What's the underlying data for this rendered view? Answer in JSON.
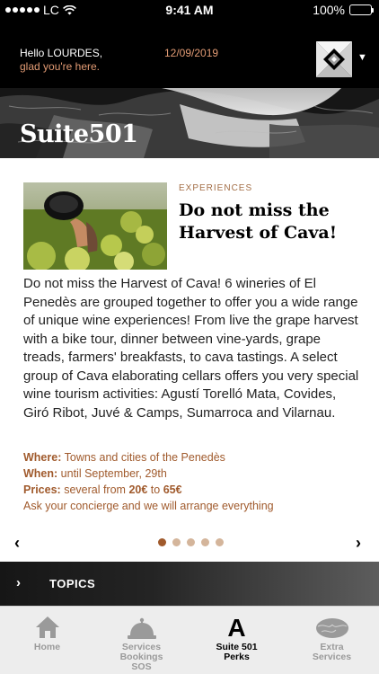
{
  "status_bar": {
    "carrier": "LC",
    "time": "9:41 AM",
    "battery": "100%",
    "battery_level": 1.0
  },
  "header": {
    "greeting_line1": "Hello LOURDES,",
    "greeting_line2": "glad you're here.",
    "date": "12/09/2019",
    "logo_icon": "diamond-logo-icon",
    "menu_icon": "caret-down-icon"
  },
  "hero": {
    "title": "Suite501"
  },
  "article": {
    "category": "EXPERIENCES",
    "title": "Do not miss the Harvest of Cava!",
    "body": "Do not miss the Harvest of Cava! 6 wineries of El Penedès are grouped together to offer you a wide range of unique wine experiences! From live the grape harvest with a bike tour, dinner between vine-yards, grape treads, farmers' breakfasts, to cava tastings. A select group of Cava elaborating cellars offers you very special wine tourism activities: Agustí Torelló Mata, Covides, Giró Ribot, Juvé & Camps, Sumarroca and Vilarnau.",
    "where_label": "Where:",
    "where_value": "Towns and cities of the Penedès",
    "when_label": "When:",
    "when_value": "until September, 29th",
    "prices_label": "Prices:",
    "prices_prefix": "several from",
    "price_from": "20€",
    "prices_mid": "to",
    "price_to": "65€",
    "concierge": "Ask your concierge and we will arrange everything"
  },
  "pager": {
    "prev": "‹",
    "next": "›",
    "count": 5,
    "active_index": 0
  },
  "topics": {
    "chevron": "›",
    "label": "TOPICS"
  },
  "tabs": [
    {
      "label": "Home",
      "icon": "home-icon"
    },
    {
      "label": "Services Bookings SOS",
      "icon": "service-bell-icon"
    },
    {
      "label": "Suite 501 Perks",
      "icon": "letter-a-icon",
      "glyph": "A"
    },
    {
      "label": "Extra Services",
      "icon": "plant-icon"
    }
  ],
  "colors": {
    "accent": "#a05a2c",
    "greeting_accent": "#e29b74",
    "dot_inactive": "#d4b59b"
  }
}
